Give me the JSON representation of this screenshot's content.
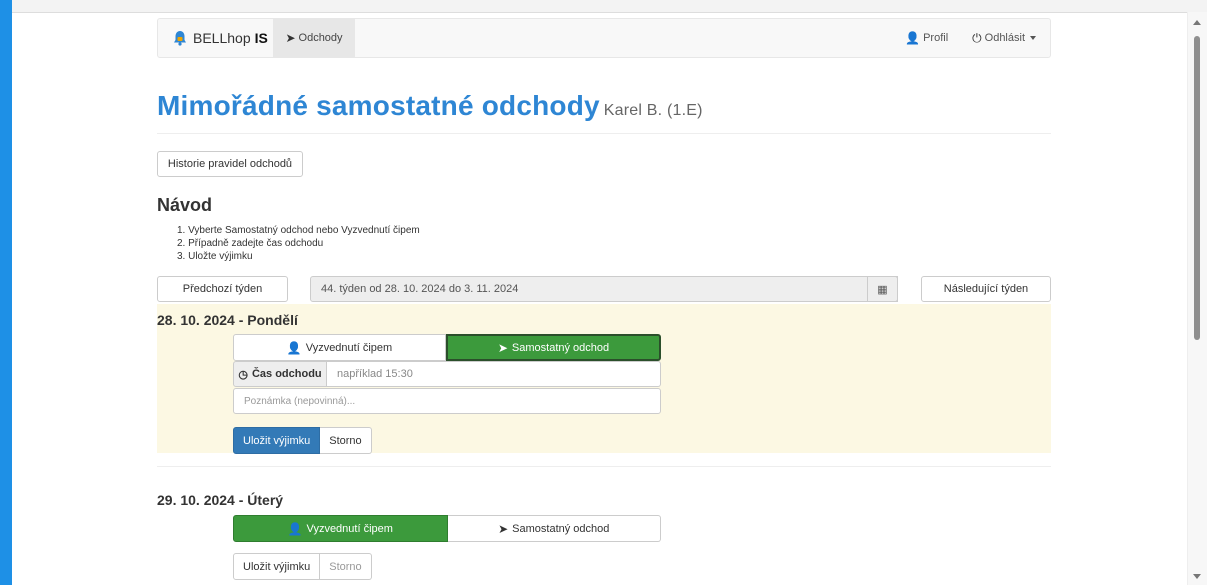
{
  "nav": {
    "brand_name": "BELLhop",
    "brand_suffix": "IS",
    "odchody": "Odchody",
    "profil": "Profil",
    "odhlasit": "Odhlásit"
  },
  "page": {
    "title": "Mimořádné samostatné odchody",
    "student": "Karel B. (1.E)",
    "history_button": "Historie pravidel odchodů"
  },
  "navod": {
    "title": "Návod",
    "steps": [
      "1. Vyberte Samostatný odchod nebo Vyzvednutí čipem",
      "2. Případně zadejte čas odchodu",
      "3. Uložte výjimku"
    ]
  },
  "week": {
    "prev": "Předchozí týden",
    "label": "44. týden od 28. 10. 2024 do 3. 11. 2024",
    "next": "Následující týden"
  },
  "days": [
    {
      "title": "28. 10. 2024 - Pondělí",
      "option_pickup": "Vyzvednutí čipem",
      "option_self": "Samostatný odchod",
      "selected": "Samostatný odchod",
      "time_label": "Čas odchodu",
      "time_placeholder": "například 15:30",
      "note_placeholder": "Poznámka (nepovinná)...",
      "save": "Uložit výjimku",
      "cancel": "Storno"
    },
    {
      "title": "29. 10. 2024 - Úterý",
      "option_pickup": "Vyzvednutí čipem",
      "option_self": "Samostatný odchod",
      "selected": "Vyzvednutí čipem",
      "save": "Uložit výjimku",
      "cancel": "Storno"
    }
  ],
  "colors": {
    "accent_blue": "#2e86d4",
    "selected_green": "#3c9a3c",
    "primary_blue": "#337ab7",
    "active_day_bg": "#fcf8e3"
  }
}
